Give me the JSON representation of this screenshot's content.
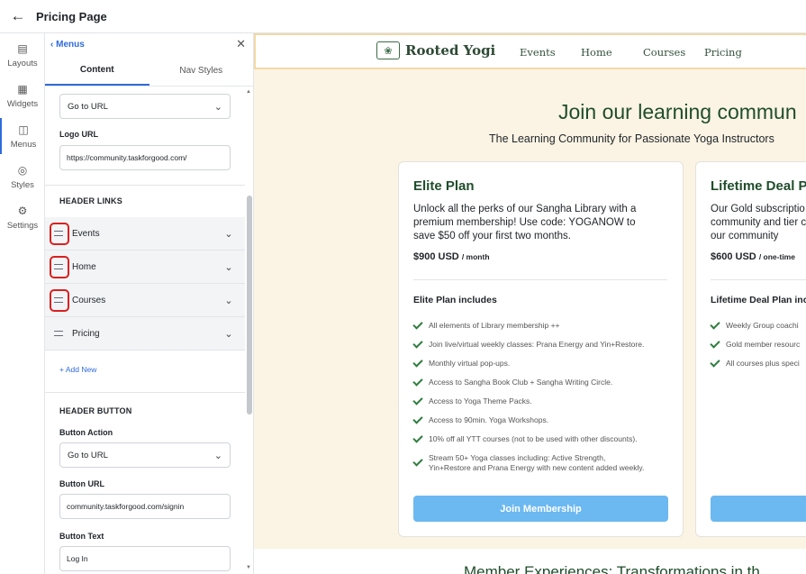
{
  "header": {
    "title": "Pricing Page"
  },
  "rail": [
    {
      "label": "Layouts",
      "icon": "layouts-icon"
    },
    {
      "label": "Widgets",
      "icon": "widgets-icon"
    },
    {
      "label": "Menus",
      "icon": "menus-icon"
    },
    {
      "label": "Styles",
      "icon": "styles-icon"
    },
    {
      "label": "Settings",
      "icon": "settings-icon"
    }
  ],
  "panel": {
    "back_label": "Menus",
    "tabs": [
      "Content",
      "Nav Styles"
    ],
    "logo_action": "Go to URL",
    "logo_url_label": "Logo URL",
    "logo_url_value": "https://community.taskforgood.com/",
    "header_links_heading": "HEADER LINKS",
    "header_links": [
      "Events",
      "Home",
      "Courses",
      "Pricing"
    ],
    "add_new": "+ Add New",
    "header_button_heading": "HEADER BUTTON",
    "button_action_label": "Button Action",
    "button_action_value": "Go to URL",
    "button_url_label": "Button URL",
    "button_url_value": "community.taskforgood.com/signin",
    "button_text_label": "Button Text",
    "button_text_value": "Log In"
  },
  "preview": {
    "brand": "Rooted Yogi",
    "nav": [
      "Events",
      "Home",
      "Courses",
      "Pricing"
    ],
    "hero_title": "Join our learning commun",
    "hero_subtitle": "The Learning Community for Passionate Yoga Instructors",
    "plans": [
      {
        "title": "Elite Plan",
        "description": "Unlock all the perks of our Sangha Library with a premium membership! Use code: YOGANOW to save $50 off your first two months.",
        "price": "$900 USD",
        "period": "/ month",
        "includes_title": "Elite Plan includes",
        "features": [
          "All elements of Library membership ++",
          "Join live/virtual weekly classes: Prana Energy and Yin+Restore.",
          "Monthly virtual pop-ups.",
          "Access to Sangha Book Club + Sangha Writing Circle.",
          "Access to Yoga Theme Packs.",
          "Access to 90min. Yoga Workshops.",
          "10% off all YTT courses (not to be used with other discounts).",
          "Stream 50+ Yoga classes including: Active Strength,",
          "Yin+Restore and Prana Energy with new content added weekly."
        ],
        "button": "Join Membership"
      },
      {
        "title": "Lifetime Deal P",
        "description_lines": [
          "Our Gold subscriptio",
          "community and tier c",
          "our community"
        ],
        "price": "$600 USD",
        "period": "/ one-time",
        "includes_title": "Lifetime Deal Plan inc",
        "features": [
          "Weekly Group coachi",
          "Gold member resourc",
          "All courses plus speci"
        ],
        "button": "Jo"
      }
    ],
    "lower_title": "Member Experiences: Transformations in th"
  },
  "colors": {
    "accent": "#2f6bdc",
    "highlight_ring": "#d92020",
    "brand_green": "#1f4d2b",
    "preview_bg": "#fbf4e4",
    "join_button": "#6cb8f0"
  }
}
